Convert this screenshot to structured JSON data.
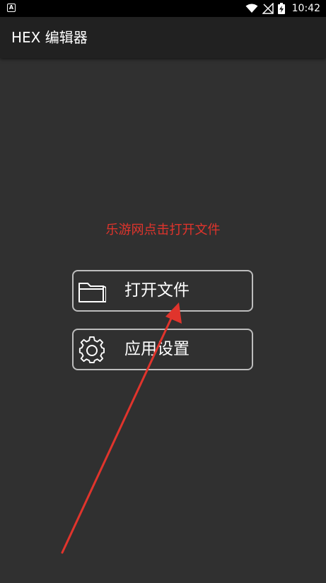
{
  "status_bar": {
    "notification_icon_letter": "A",
    "time": "10:42",
    "icons": [
      "wifi-icon",
      "no-signal-icon",
      "battery-charging-icon"
    ]
  },
  "app_bar": {
    "title": "HEX 编辑器"
  },
  "annotation": {
    "text": "乐游网点击打开文件",
    "color": "#e0342c"
  },
  "menu": {
    "open_file": {
      "label": "打开文件",
      "icon": "folder-icon"
    },
    "settings": {
      "label": "应用设置",
      "icon": "gear-icon"
    }
  },
  "colors": {
    "background": "#303030",
    "app_bar": "#212121",
    "status_bar": "#000000",
    "button_border": "#bdbdbd",
    "arrow": "#e0342c"
  }
}
